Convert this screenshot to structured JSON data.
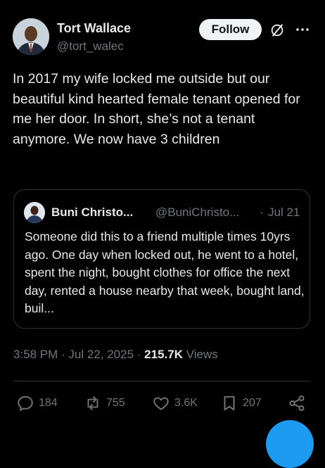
{
  "author": {
    "name": "Tort Wallace",
    "handle": "@tort_walec"
  },
  "header": {
    "follow_label": "Follow",
    "icons": [
      "grok-icon",
      "more-icon"
    ]
  },
  "tweet": {
    "text": "In 2017 my wife locked me outside but our beautiful kind hearted female tenant opened for me her door. In short, she’s not a tenant anymore. We now have 3 children"
  },
  "quote": {
    "name": "Buni Christo...",
    "handle": "@BuniChristo...",
    "separator": "·",
    "date": "Jul 21",
    "text": "Someone did this to a friend multiple times 10yrs ago. One day when locked out, he went to a hotel, spent the night, bought clothes for office the next day, rented a house nearby that week, bought land, buil..."
  },
  "meta": {
    "time": "3:58 PM",
    "sep1": " · ",
    "date": "Jul 22, 2025",
    "sep2": " · ",
    "views": "215.7K",
    "views_label": "Views"
  },
  "actions": {
    "replies": "184",
    "reposts": "755",
    "likes": "3.6K",
    "bookmarks": "207"
  },
  "colors": {
    "background": "#000000",
    "text": "#e7e9ea",
    "muted": "#71767b",
    "border": "#2f3336",
    "accent": "#1d9bf0"
  }
}
